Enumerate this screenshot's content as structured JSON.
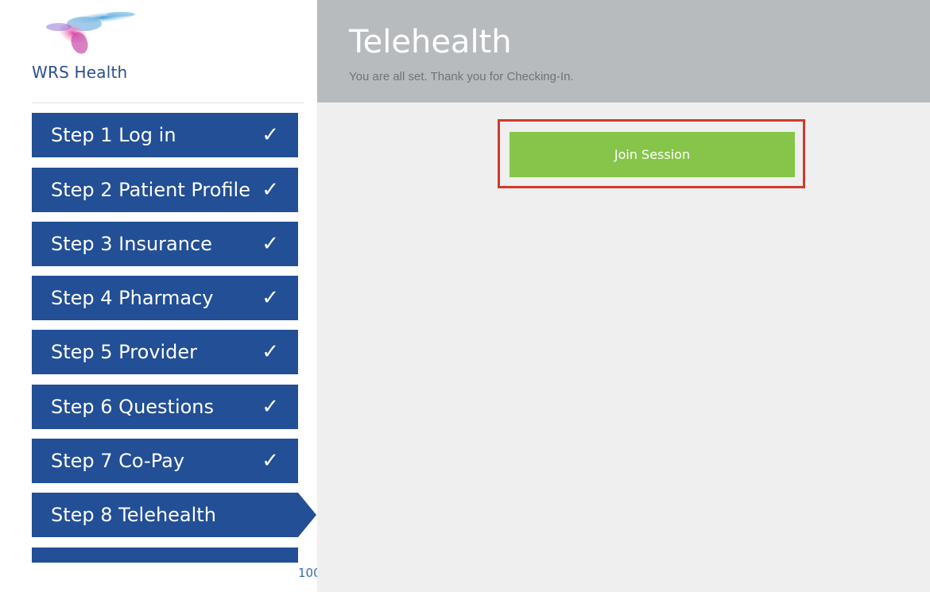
{
  "brand": {
    "name": "WRS Health",
    "logo_icon": "wrs-health-hummingbird-logo"
  },
  "sidebar": {
    "steps": [
      {
        "label": "Step 1 Log in",
        "check": "✓",
        "status": "complete"
      },
      {
        "label": "Step 2 Patient Profile",
        "check": "✓",
        "status": "complete"
      },
      {
        "label": "Step 3 Insurance",
        "check": "✓",
        "status": "complete"
      },
      {
        "label": "Step 4 Pharmacy",
        "check": "✓",
        "status": "complete"
      },
      {
        "label": "Step 5 Provider",
        "check": "✓",
        "status": "complete"
      },
      {
        "label": "Step 6 Questions",
        "check": "✓",
        "status": "complete"
      },
      {
        "label": "Step 7 Co-Pay",
        "check": "✓",
        "status": "complete"
      },
      {
        "label": "Step 8 Telehealth",
        "check": "",
        "status": "active"
      }
    ],
    "pager_text": "100"
  },
  "main": {
    "title": "Telehealth",
    "subtitle": "You are all set. Thank you for Checking-In.",
    "join_button_label": "Join Session"
  },
  "colors": {
    "step_bg": "#224f96",
    "header_bg": "#b8bbbe",
    "content_bg": "#efefef",
    "join_button": "#86c549",
    "highlight_border": "#d13a2a",
    "brand_text": "#2b4f8f"
  }
}
